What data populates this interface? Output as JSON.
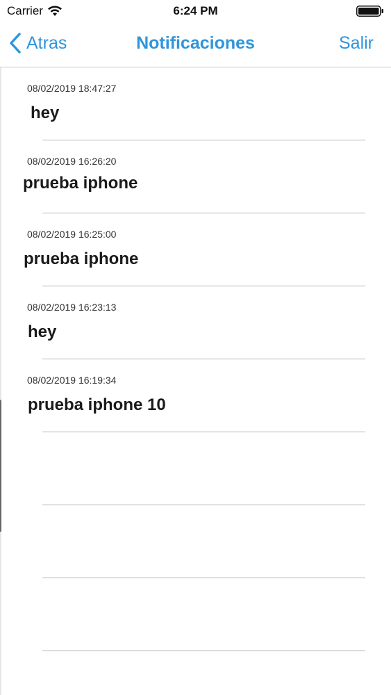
{
  "status_bar": {
    "carrier": "Carrier",
    "time": "6:24 PM"
  },
  "nav": {
    "back_label": "Atras",
    "title": "Notificaciones",
    "logout_label": "Salir",
    "accent_color": "#2f95dc"
  },
  "notifications": [
    {
      "date": "08/02/2019 18:47:27",
      "message": "hey"
    },
    {
      "date": "08/02/2019 16:26:20",
      "message": "prueba iphone"
    },
    {
      "date": "08/02/2019 16:25:00",
      "message": "prueba iphone"
    },
    {
      "date": "08/02/2019 16:23:13",
      "message": "hey"
    },
    {
      "date": "08/02/2019 16:19:34",
      "message": "prueba iphone 10"
    },
    {
      "date": "",
      "message": ""
    },
    {
      "date": "",
      "message": ""
    },
    {
      "date": "",
      "message": ""
    }
  ]
}
